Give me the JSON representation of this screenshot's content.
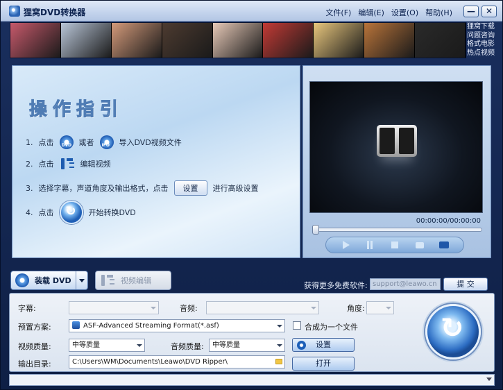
{
  "app": {
    "title": "狸窝DVD转换器"
  },
  "menu": [
    {
      "label": "文件(F)"
    },
    {
      "label": "编辑(E)"
    },
    {
      "label": "设置(O)"
    },
    {
      "label": "帮助(H)"
    }
  ],
  "window_buttons": {
    "minimize": "—",
    "close": "✕"
  },
  "banner": {
    "posters": [
      "#c7596b",
      "#b9c6d8",
      "#d49a7a",
      "#4d3b30",
      "#e7c9b7",
      "#c23a35",
      "#e9c77d",
      "#b9743a",
      "#2a2a2a"
    ],
    "promo": [
      "狸窝下载",
      "问题咨询",
      "格式电影",
      "热点视频"
    ]
  },
  "guide": {
    "title": "操作指引",
    "step1": {
      "num": "1.",
      "pre": "点击",
      "disc1_tag": "DVD",
      "mid": "或者",
      "disc2_tag": "IFO",
      "post": "导入DVD视频文件"
    },
    "step2": {
      "num": "2.",
      "pre": "点击",
      "post": "编辑视频"
    },
    "step3": {
      "num": "3.",
      "pre": "选择字幕，声道角度及输出格式，点击",
      "button": "设置",
      "post": "进行高级设置"
    },
    "step4": {
      "num": "4.",
      "pre": "点击",
      "post": "开始转换DVD"
    }
  },
  "player": {
    "timecode": "00:00:00/00:00:00"
  },
  "toolbar": {
    "load_dvd": "装载 DVD",
    "edit_video": "视频编辑",
    "promo_label": "获得更多免费软件:",
    "email_placeholder": "support@leawo.cn",
    "submit": "提 交"
  },
  "settings": {
    "subtitle_label": "字幕:",
    "subtitle_value": "",
    "audio_label": "音频:",
    "audio_value": "",
    "angle_label": "角度:",
    "angle_value": "",
    "preset_label": "预置方案:",
    "preset_value": "ASF-Advanced Streaming Format(*.asf)",
    "merge_label": "合成为一个文件",
    "video_quality_label": "视频质量:",
    "video_quality_value": "中等质量",
    "audio_quality_label": "音频质量:",
    "audio_quality_value": "中等质量",
    "settings_button": "设置",
    "output_label": "输出目录:",
    "output_path": "C:\\Users\\WM\\Documents\\Leawo\\DVD Ripper\\",
    "open_button": "打开"
  },
  "colors": {
    "accent": "#1e5fb6",
    "frame": "#0e1f45"
  }
}
